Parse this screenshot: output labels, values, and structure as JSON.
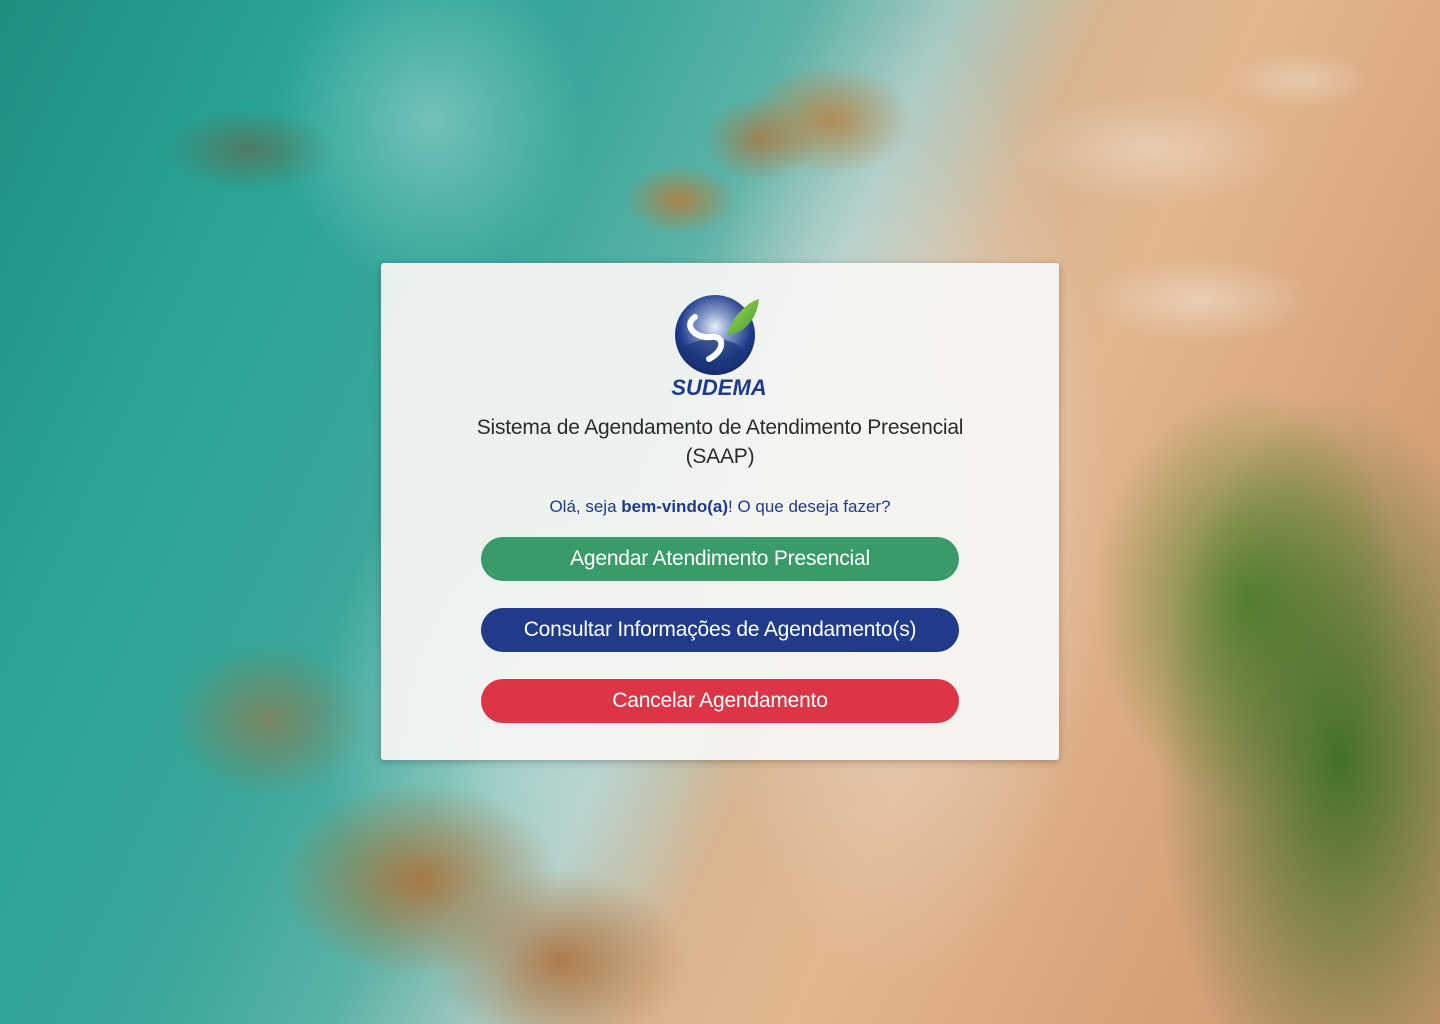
{
  "logo": {
    "text": "SUDEMA",
    "colors": {
      "sphere": "#1f3b8a",
      "leaf": "#6bbf3b"
    }
  },
  "title": {
    "line1": "Sistema de Agendamento de Atendimento Presencial",
    "line2": "(SAAP)"
  },
  "greeting": {
    "prefix": "Olá, seja ",
    "emphasis": "bem-vindo(a)",
    "suffix": "! O que deseja fazer?"
  },
  "actions": {
    "schedule": "Agendar Atendimento Presencial",
    "consult": "Consultar Informações de Agendamento(s)",
    "cancel": "Cancelar Agendamento"
  },
  "colors": {
    "schedule": "#3a9b6a",
    "consult": "#1f3b8a",
    "cancel": "#dc3545",
    "greeting_text": "#1f3a8a"
  }
}
